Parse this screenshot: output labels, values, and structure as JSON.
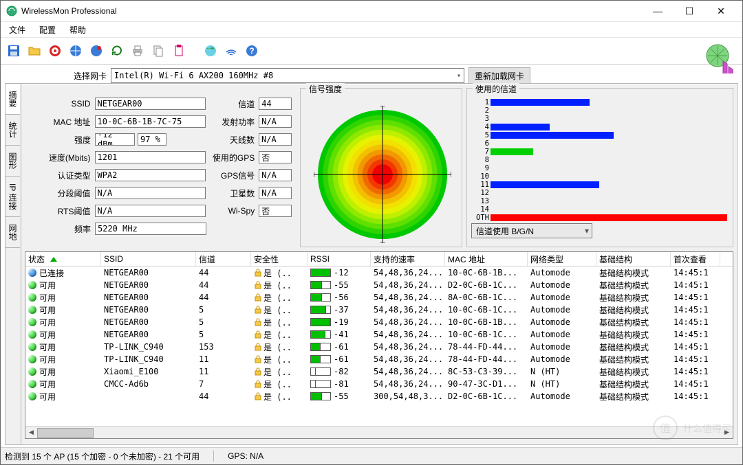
{
  "title": "WirelessMon Professional",
  "menu": {
    "file": "文件",
    "config": "配置",
    "help": "帮助"
  },
  "nic": {
    "label": "选择网卡",
    "value": "Intel(R) Wi-Fi 6 AX200 160MHz #8",
    "reload": "重新加载网卡"
  },
  "vtabs": [
    "摘要",
    "统计",
    "图形",
    "IP 连接",
    "网地"
  ],
  "info": {
    "labels": {
      "ssid": "SSID",
      "mac": "MAC 地址",
      "strength": "强度",
      "speed": "速度(Mbits)",
      "auth": "认证类型",
      "frag": "分段阈值",
      "rts": "RTS阈值",
      "freq": "频率",
      "channel": "信道",
      "txpower": "发射功率",
      "antenna": "天线数",
      "gps": "使用的GPS",
      "gpssig": "GPS信号",
      "sat": "卫星数",
      "wispy": "Wi-Spy"
    },
    "ssid": "NETGEAR00",
    "mac": "10-0C-6B-1B-7C-75",
    "strength_dbm": "-12 dBm",
    "strength_pct": "97 %",
    "speed": "1201",
    "auth": "WPA2",
    "frag": "N/A",
    "rts": "N/A",
    "freq": "5220 MHz",
    "channel": "44",
    "txpower": "N/A",
    "antenna": "N/A",
    "gps": "否",
    "gpssig": "N/A",
    "sat": "N/A",
    "wispy": "否"
  },
  "signal_title": "信号强度",
  "channels_title": "使用的信道",
  "channels_dropdown": "信道使用 B/G/N",
  "chart_data": {
    "type": "bar",
    "title": "使用的信道",
    "xlabel": "",
    "ylabel": "",
    "ylim": [
      0,
      100
    ],
    "categories": [
      "1",
      "2",
      "3",
      "4",
      "5",
      "6",
      "7",
      "8",
      "9",
      "10",
      "11",
      "12",
      "13",
      "14",
      "OTH"
    ],
    "series": [
      {
        "name": "blue",
        "color": "#0020ff",
        "values": [
          42,
          0,
          0,
          25,
          52,
          0,
          0,
          0,
          0,
          0,
          46,
          0,
          0,
          0,
          0
        ]
      },
      {
        "name": "green",
        "color": "#00d000",
        "values": [
          0,
          0,
          0,
          0,
          0,
          0,
          18,
          0,
          0,
          0,
          0,
          0,
          0,
          0,
          0
        ]
      },
      {
        "name": "red",
        "color": "#ff0000",
        "values": [
          0,
          0,
          0,
          0,
          0,
          0,
          0,
          0,
          0,
          0,
          0,
          0,
          0,
          0,
          100
        ]
      }
    ]
  },
  "grid": {
    "cols": [
      "状态",
      "SSID",
      "信道",
      "安全性",
      "RSSI",
      "支持的速率",
      "MAC 地址",
      "网络类型",
      "基础结构",
      "首次查看"
    ],
    "rows": [
      {
        "st": "已连接",
        "dot": "blue",
        "ssid": "NETGEAR00",
        "ch": "44",
        "sec": "是 (..",
        "rssi": -12,
        "rates": "54,48,36,24...",
        "mac": "10-0C-6B-1B...",
        "net": "Automode",
        "infra": "基础结构模式",
        "first": "14:45:1"
      },
      {
        "st": "可用",
        "dot": "green",
        "ssid": "NETGEAR00",
        "ch": "44",
        "sec": "是 (..",
        "rssi": -55,
        "rates": "54,48,36,24...",
        "mac": "D2-0C-6B-1C...",
        "net": "Automode",
        "infra": "基础结构模式",
        "first": "14:45:1"
      },
      {
        "st": "可用",
        "dot": "green",
        "ssid": "NETGEAR00",
        "ch": "44",
        "sec": "是 (..",
        "rssi": -56,
        "rates": "54,48,36,24...",
        "mac": "8A-0C-6B-1C...",
        "net": "Automode",
        "infra": "基础结构模式",
        "first": "14:45:1"
      },
      {
        "st": "可用",
        "dot": "green",
        "ssid": "NETGEAR00",
        "ch": "5",
        "sec": "是 (..",
        "rssi": -37,
        "rates": "54,48,36,24...",
        "mac": "10-0C-6B-1C...",
        "net": "Automode",
        "infra": "基础结构模式",
        "first": "14:45:1"
      },
      {
        "st": "可用",
        "dot": "green",
        "ssid": "NETGEAR00",
        "ch": "5",
        "sec": "是 (..",
        "rssi": -19,
        "rates": "54,48,36,24...",
        "mac": "10-0C-6B-1B...",
        "net": "Automode",
        "infra": "基础结构模式",
        "first": "14:45:1"
      },
      {
        "st": "可用",
        "dot": "green",
        "ssid": "NETGEAR00",
        "ch": "5",
        "sec": "是 (..",
        "rssi": -41,
        "rates": "54,48,36,24...",
        "mac": "10-0C-6B-1C...",
        "net": "Automode",
        "infra": "基础结构模式",
        "first": "14:45:1"
      },
      {
        "st": "可用",
        "dot": "green",
        "ssid": "TP-LINK_C940",
        "ch": "153",
        "sec": "是 (..",
        "rssi": -61,
        "rates": "54,48,36,24...",
        "mac": "78-44-FD-44...",
        "net": "Automode",
        "infra": "基础结构模式",
        "first": "14:45:1"
      },
      {
        "st": "可用",
        "dot": "green",
        "ssid": "TP-LINK_C940",
        "ch": "11",
        "sec": "是 (..",
        "rssi": -61,
        "rates": "54,48,36,24...",
        "mac": "78-44-FD-44...",
        "net": "Automode",
        "infra": "基础结构模式",
        "first": "14:45:1"
      },
      {
        "st": "可用",
        "dot": "green",
        "ssid": "Xiaomi_E100",
        "ch": "11",
        "sec": "是 (..",
        "rssi": -82,
        "rates": "54,48,36,24...",
        "mac": "8C-53-C3-39...",
        "net": "N (HT)",
        "infra": "基础结构模式",
        "first": "14:45:1"
      },
      {
        "st": "可用",
        "dot": "green",
        "ssid": "CMCC-Ad6b",
        "ch": "7",
        "sec": "是 (..",
        "rssi": -81,
        "rates": "54,48,36,24...",
        "mac": "90-47-3C-D1...",
        "net": "N (HT)",
        "infra": "基础结构模式",
        "first": "14:45:1"
      },
      {
        "st": "可用",
        "dot": "green",
        "ssid": "",
        "ch": "44",
        "sec": "是 (..",
        "rssi": -55,
        "rates": "300,54,48,3...",
        "mac": "D2-0C-6B-1C...",
        "net": "Automode",
        "infra": "基础结构模式",
        "first": "14:45:1"
      }
    ]
  },
  "status": {
    "ap": "检测到 15 个 AP (15 个加密 - 0 个未加密) - 21 个可用",
    "gps": "GPS: N/A"
  },
  "watermark": "值 什么值得买"
}
